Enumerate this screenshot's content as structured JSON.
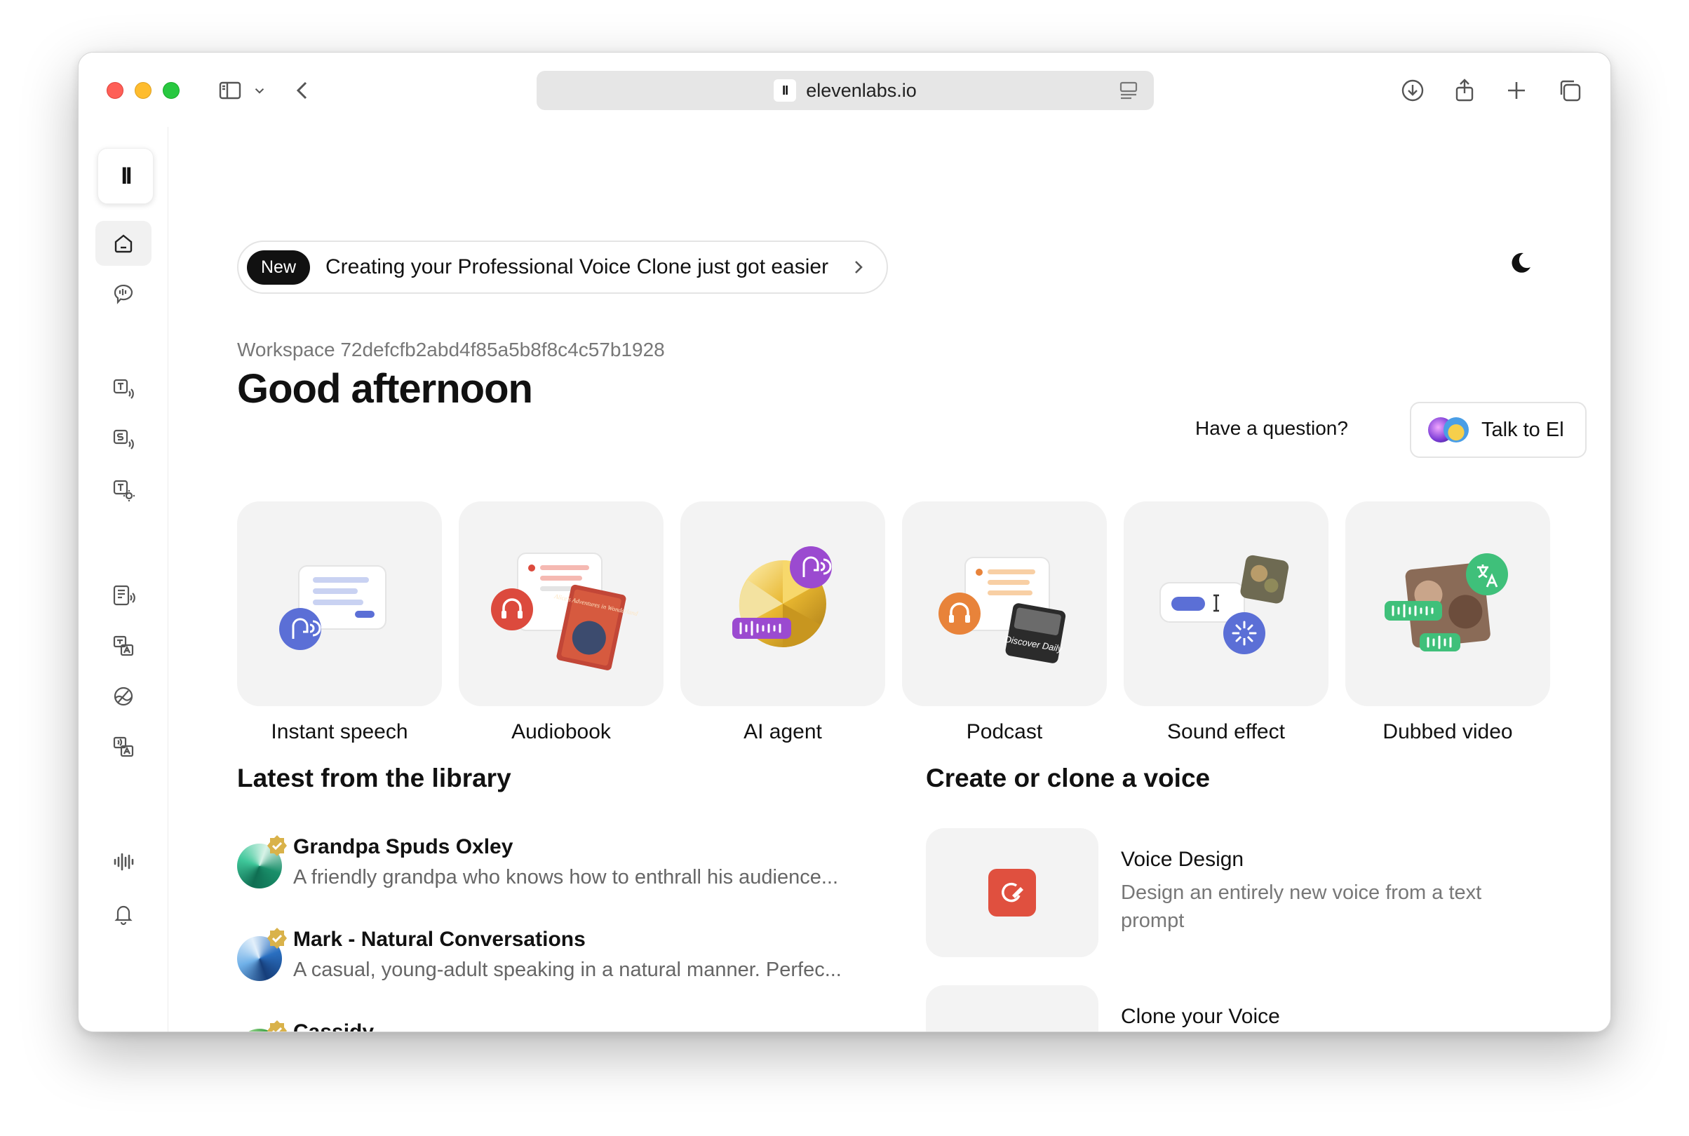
{
  "browser": {
    "url": "elevenlabs.io",
    "favicon_text": "II"
  },
  "sidebar": {
    "logo_text": "II",
    "items": [
      {
        "name": "home",
        "icon": "home-icon",
        "active": true
      },
      {
        "name": "voices",
        "icon": "speech-bubble-icon"
      },
      {
        "name": "text-to-speech",
        "icon": "text-to-speech-icon"
      },
      {
        "name": "speech-to-speech",
        "icon": "speech-to-speech-icon"
      },
      {
        "name": "sound-effects",
        "icon": "sound-effects-icon"
      },
      {
        "name": "projects",
        "icon": "document-audio-icon"
      },
      {
        "name": "dubbing",
        "icon": "translate-icon"
      },
      {
        "name": "voice-isolator",
        "icon": "voice-isolator-icon"
      },
      {
        "name": "voiceover",
        "icon": "voiceover-icon"
      },
      {
        "name": "waveform",
        "icon": "waveform-icon"
      },
      {
        "name": "notifications",
        "icon": "bell-icon"
      }
    ]
  },
  "announcement": {
    "badge": "New",
    "text": "Creating your Professional Voice Clone just got easier"
  },
  "workspace_label": "Workspace 72defcfb2abd4f85a5b8f8c4c57b1928",
  "greeting": "Good afternoon",
  "question_text": "Have a question?",
  "talk_button": "Talk to El",
  "quick_actions": [
    {
      "label": "Instant speech",
      "accent": "#5b6fd6"
    },
    {
      "label": "Audiobook",
      "accent": "#dc4a3d"
    },
    {
      "label": "AI agent",
      "accent": "#9b4ad0"
    },
    {
      "label": "Podcast",
      "accent": "#e8833a"
    },
    {
      "label": "Sound effect",
      "accent": "#5b6fd6"
    },
    {
      "label": "Dubbed video",
      "accent": "#3fc07a"
    }
  ],
  "tile_texts": {
    "audiobook_cover": "Alice's Adventures in Wonderland",
    "podcast_cover": "Discover Daily"
  },
  "library": {
    "title": "Latest from the library",
    "items": [
      {
        "name": "Grandpa Spuds Oxley",
        "description": "A friendly grandpa who knows how to enthrall his audience...",
        "avatar_colors": [
          "#1a8f6a",
          "#bfe8d8"
        ]
      },
      {
        "name": "Mark - Natural Conversations",
        "description": "A casual, young-adult speaking in a natural manner. Perfec...",
        "avatar_colors": [
          "#1f5fae",
          "#b9d9f4"
        ]
      },
      {
        "name": "Cassidy",
        "description": "",
        "avatar_colors": [
          "#2f9a3a",
          "#a6e08e"
        ]
      }
    ]
  },
  "voice": {
    "title": "Create or clone a voice",
    "items": [
      {
        "title": "Voice Design",
        "description": "Design an entirely new voice from a text prompt",
        "icon_color": "#e0503f"
      },
      {
        "title": "Clone your Voice",
        "description": "",
        "icon_color": "#3fc07a"
      }
    ]
  },
  "colors": {
    "badge_bg": "#111111",
    "tile_bg": "#f3f3f3",
    "muted_text": "#777777",
    "verified": "#d9b24a"
  }
}
